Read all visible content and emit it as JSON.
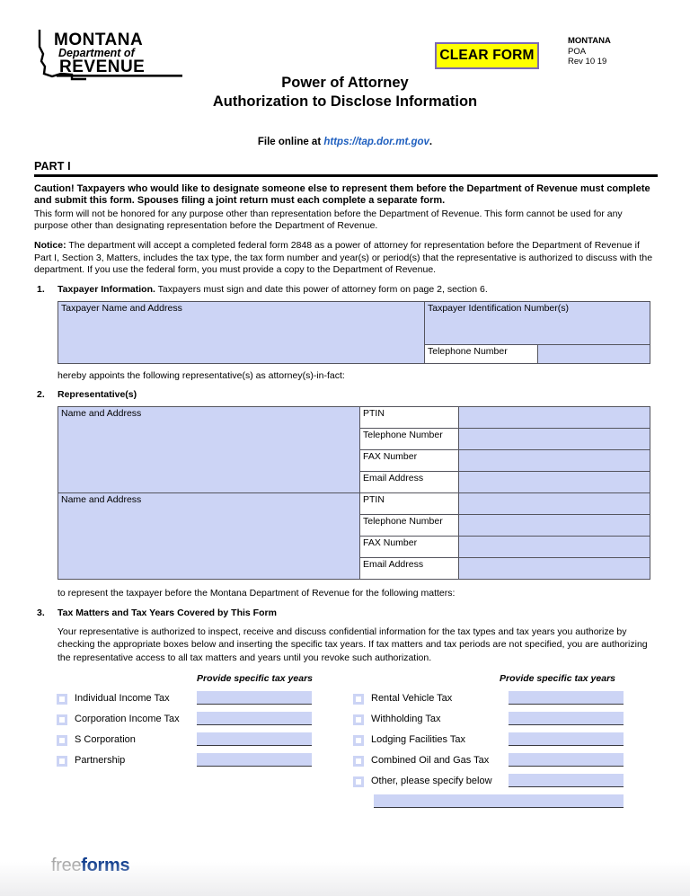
{
  "header": {
    "agency_line1": "MONTANA",
    "agency_line2": "Department of",
    "agency_line3": "REVENUE",
    "clear_form_label": "CLEAR FORM",
    "form_id_line1": "MONTANA",
    "form_id_line2": "POA",
    "form_id_line3": "Rev 10 19",
    "title_line1": "Power of Attorney",
    "title_line2": "Authorization to Disclose Information",
    "file_online_prefix": "File online at ",
    "file_online_url": "https://tap.dor.mt.gov",
    "file_online_suffix": "."
  },
  "part": {
    "label": "PART I"
  },
  "caution": {
    "bold_text": "Caution! Taxpayers who would like to designate someone else to represent them before the Department of Revenue must complete and submit this form. Spouses filing a joint return must each complete a separate form.",
    "body_text": "This form will not be honored for any purpose other than representation before the Department of Revenue. This form cannot be used for any purpose other than designating representation before the Department of Revenue."
  },
  "notice": {
    "lead": "Notice:",
    "body": " The department will accept a completed federal form 2848 as a power of attorney for representation before the Department of Revenue if Part I, Section 3, Matters, includes the tax type, the tax form number and year(s) or period(s) that the representative is authorized to discuss with the department. If you use the federal form, you must provide a copy to the Department of Revenue."
  },
  "section1": {
    "number": "1.",
    "heading": "Taxpayer Information.",
    "subtext": " Taxpayers must sign and date this power of attorney form on page 2, section 6.",
    "name_address_label": "Taxpayer Name and Address",
    "tin_label": "Taxpayer Identification Number(s)",
    "telephone_label": "Telephone Number",
    "name_address_value": "",
    "tin_value": "",
    "telephone_value": ""
  },
  "appoints_text": "hereby appoints the following representative(s) as attorney(s)-in-fact:",
  "section2": {
    "number": "2.",
    "heading": "Representative(s)",
    "representatives": [
      {
        "name_address_label": "Name and Address",
        "name_address_value": "",
        "fields": [
          {
            "label": "PTIN",
            "value": ""
          },
          {
            "label": "Telephone Number",
            "value": ""
          },
          {
            "label": "FAX Number",
            "value": ""
          },
          {
            "label": "Email Address",
            "value": ""
          }
        ]
      },
      {
        "name_address_label": "Name and Address",
        "name_address_value": "",
        "fields": [
          {
            "label": "PTIN",
            "value": ""
          },
          {
            "label": "Telephone Number",
            "value": ""
          },
          {
            "label": "FAX Number",
            "value": ""
          },
          {
            "label": "Email Address",
            "value": ""
          }
        ]
      }
    ]
  },
  "represent_text": "to represent the taxpayer before the Montana Department of Revenue for the following matters:",
  "section3": {
    "number": "3.",
    "heading": "Tax Matters and Tax Years Covered by This Form",
    "body": "Your representative is authorized to inspect, receive and discuss confidential information for the tax types and tax years you authorize by checking the appropriate boxes below and inserting the specific tax years. If tax matters and tax periods are not specified, you are authorizing the representative access to all tax matters and years until you revoke such authorization.",
    "provide_years_label_left": "Provide specific tax years",
    "provide_years_label_right": "Provide specific tax years",
    "left_items": [
      {
        "label": "Individual Income Tax",
        "checked": false,
        "years": ""
      },
      {
        "label": "Corporation Income Tax",
        "checked": false,
        "years": ""
      },
      {
        "label": "S Corporation",
        "checked": false,
        "years": ""
      },
      {
        "label": "Partnership",
        "checked": false,
        "years": ""
      }
    ],
    "right_items": [
      {
        "label": "Rental Vehicle Tax",
        "checked": false,
        "years": ""
      },
      {
        "label": "Withholding Tax",
        "checked": false,
        "years": ""
      },
      {
        "label": "Lodging Facilities Tax",
        "checked": false,
        "years": ""
      },
      {
        "label": "Combined Oil and Gas Tax",
        "checked": false,
        "years": ""
      },
      {
        "label": "Other, please specify below",
        "checked": false,
        "years": ""
      }
    ],
    "other_specify_value": ""
  },
  "footer": {
    "logo_part1": "free",
    "logo_part2": "forms"
  }
}
